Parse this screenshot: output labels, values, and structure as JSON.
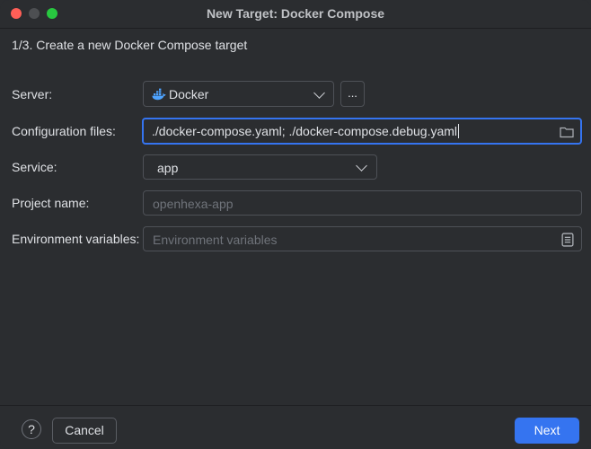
{
  "window": {
    "title": "New Target: Docker Compose"
  },
  "step": {
    "text": "1/3. Create a new Docker Compose target"
  },
  "form": {
    "server": {
      "label": "Server:",
      "value": "Docker",
      "icon": "docker-icon",
      "browse_label": "..."
    },
    "configuration_files": {
      "label": "Configuration files:",
      "value": "./docker-compose.yaml; ./docker-compose.debug.yaml",
      "icon": "folder-icon"
    },
    "service": {
      "label": "Service:",
      "value": "app"
    },
    "project_name": {
      "label": "Project name:",
      "placeholder": "openhexa-app"
    },
    "environment_variables": {
      "label": "Environment variables:",
      "placeholder": "Environment variables",
      "icon": "document-icon"
    }
  },
  "footer": {
    "help_label": "?",
    "cancel_label": "Cancel",
    "next_label": "Next"
  },
  "colors": {
    "accent": "#3574f0",
    "background": "#2b2d30"
  }
}
